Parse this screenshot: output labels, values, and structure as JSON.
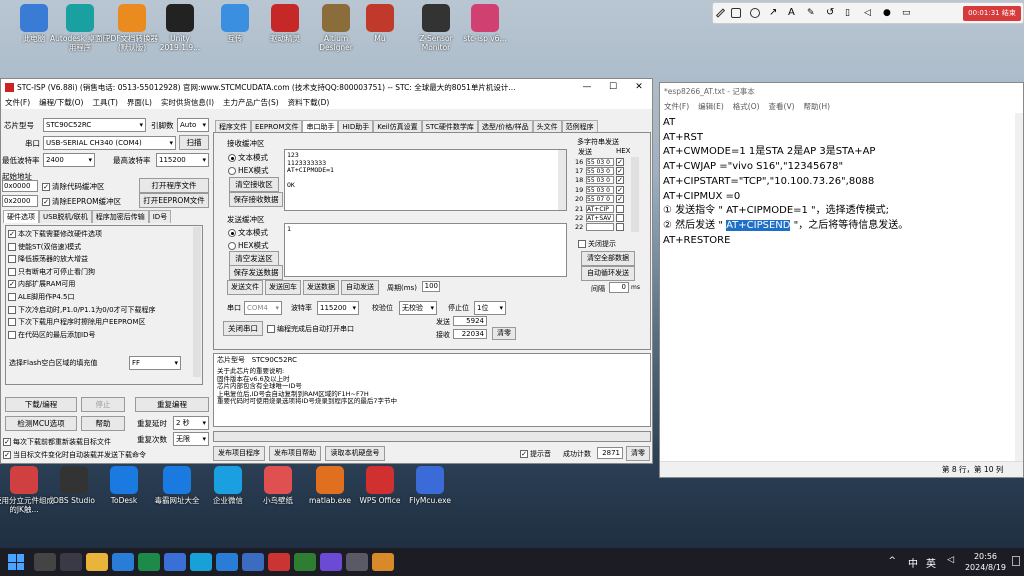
{
  "desktop": {
    "top_icons": [
      "此电脑",
      "Autodesk 桌面应用程序",
      "PDF文档转换器(默认版)",
      "Unity 2019.1.9...",
      "互传",
      "驱动精灵",
      "Altium Designer",
      "Mu",
      "Z-Sensor Monitor",
      "stc-isp v6..."
    ],
    "bottom_icons": [
      "使用分立元件组成的JK触...",
      "OBS Studio",
      "ToDesk",
      "毒霸网址大全",
      "企业微信",
      "小鸟壁纸",
      "matlab.exe",
      "WPS Office",
      "FlyMcu.exe"
    ]
  },
  "recorder": {
    "time": "00:01:31",
    "stop": "结束"
  },
  "stc": {
    "title": "STC-ISP (V6.88i) (销售电话: 0513-55012928) 官网:www.STCMCUDATA.com (技术支持QQ:800003751) -- STC: 全球最大的8051单片机设计...",
    "menu": [
      "文件(F)",
      "编程/下载(O)",
      "工具(T)",
      "界面(L)",
      "实时供货信息(I)",
      "主力产品广告(S)",
      "资料下载(D)"
    ],
    "chip_label": "芯片型号",
    "chip": "STC90C52RC",
    "pins_label": "引脚数",
    "pins": "Auto",
    "port_label": "串口",
    "port": "USB-SERIAL CH340 (COM4)",
    "scan": "扫描",
    "min_baud_label": "最低波特率",
    "min_baud": "2400",
    "max_baud_label": "最高波特率",
    "max_baud": "115200",
    "start_addr_label": "起始地址",
    "addr1": "0x0000",
    "clear_code": "清除代码缓冲区",
    "open_prog": "打开程序文件",
    "addr2": "0x2000",
    "clear_eeprom": "清除EEPROM缓冲区",
    "open_eeprom": "打开EEPROM文件",
    "left_tabs": [
      "硬件选项",
      "USB脱机/联机",
      "程序加密后传输",
      "ID号"
    ],
    "options": [
      {
        "text": "本次下载需要修改硬件选项",
        "checked": true
      },
      {
        "text": "使能ST(双倍速)模式",
        "checked": false
      },
      {
        "text": "降低振荡器的放大增益",
        "checked": false
      },
      {
        "text": "只有断电才可停止看门狗",
        "checked": false
      },
      {
        "text": "内部扩展RAM可用",
        "checked": true
      },
      {
        "text": "ALE脚用作P4.5口",
        "checked": false
      },
      {
        "text": "下次冷启动时,P1.0/P1.1为0/0才可下载程序",
        "checked": false
      },
      {
        "text": "下次下载用户程序时擦除用户EEPROM区",
        "checked": false
      },
      {
        "text": "在代码区的最后添加ID号",
        "checked": false
      }
    ],
    "fill_label": "选择Flash空白区域的填充值",
    "fill": "FF",
    "btn_download": "下载/编程",
    "btn_stop": "停止",
    "btn_reprog": "重复编程",
    "btn_detect": "检测MCU选项",
    "btn_help": "帮助",
    "delay_label": "重复延时",
    "delay": "2 秒",
    "repeat_label": "重复次数",
    "repeat": "无限",
    "reload": "每次下载前都重新装载目标文件",
    "auto_send": "当目标文件变化时自动装载并发送下载命令",
    "right_tabs": [
      "程序文件",
      "EEPROM文件",
      "串口助手",
      "HID助手",
      "Keil仿真设置",
      "STC硬件数学库",
      "选型/价格/样品",
      "头文件",
      "范例程序"
    ],
    "recv_label": "接收缓冲区",
    "text_mode": "文本模式",
    "hex_mode": "HEX模式",
    "clear_recv": "清空接收区",
    "save_recv": "保存接收数据",
    "recv_text": [
      "123",
      "1123333333",
      "AT+CIPMODE=1",
      "",
      "OK"
    ],
    "send_label": "发送缓冲区",
    "clear_send": "清空发送区",
    "save_send": "保存发送数据",
    "send_text": "1",
    "multi_label": "多字符串发送",
    "send_col": "发送",
    "hex_col": "HEX",
    "multi_rows": [
      {
        "n": "16",
        "v": "55 03 0"
      },
      {
        "n": "17",
        "v": "55 03 0"
      },
      {
        "n": "18",
        "v": "55 03 0"
      },
      {
        "n": "19",
        "v": "55 03 0"
      },
      {
        "n": "20",
        "v": "55 07 0"
      },
      {
        "n": "21",
        "v": "AT+CIP"
      },
      {
        "n": "22",
        "v": "AT+SAV"
      },
      {
        "n": "22",
        "v": ""
      }
    ],
    "close_hint": "关闭提示",
    "clear_all": "清空全部数据",
    "auto_loop": "自动循环发送",
    "interval_label": "间隔",
    "interval": "0",
    "ms": "ms",
    "send_file": "发送文件",
    "send_return": "发送回车",
    "send_data": "发送数据",
    "auto_send_btn": "自动发送",
    "period_label": "周期(ms)",
    "period": "100",
    "port2_label": "串口",
    "port2": "COM4",
    "baud_label": "波特率",
    "baud": "115200",
    "parity_label": "校验位",
    "parity": "无校验",
    "stop_label": "停止位",
    "stop": "1位",
    "close_port": "关闭串口",
    "auto_open": "编程完成后自动打开串口",
    "sent_label": "发送",
    "sent": "5924",
    "recv_count_label": "接收",
    "recv_count": "22034",
    "zero": "清零",
    "chip_info_label": "芯片型号",
    "chip_info": "STC90C52RC",
    "info_lines": [
      "关于此芯片的重要说明:",
      "  固件版本在v6.6及以上时",
      "    芯片内部包含有全球唯一ID号",
      "    上电复位后,ID号会自动复制到RAM区域的F1H~F7H",
      "    重要代码时可使用烧录选项将ID号烧录到程序区的最后7字节中"
    ],
    "publish": "发布项目程序",
    "publish_help": "发布项目帮助",
    "read_disk": "读取本机硬盘号",
    "beep": "提示音",
    "success_label": "成功计数",
    "success": "2871",
    "clear": "清零"
  },
  "notepad": {
    "title": "*esp8266_AT.txt - 记事本",
    "menu": [
      "文件(F)",
      "编辑(E)",
      "格式(O)",
      "查看(V)",
      "帮助(H)"
    ],
    "lines": [
      {
        "t": "AT"
      },
      {
        "t": "AT+RST"
      },
      {
        "t": "AT+CWMODE=1       1是STA   2是AP   3是STA+AP"
      },
      {
        "t": "AT+CWJAP =\"vivo S16\",\"12345678\""
      },
      {
        "t": "AT+CIPSTART=\"TCP\",\"10.100.73.26\",8088"
      },
      {
        "t": "AT+CIPMUX =0"
      },
      {
        "t": "① 发送指令 \" AT+CIPMODE=1 \"，选择透传模式;"
      },
      {
        "pre": "② 然后发送 \" ",
        "hl": "AT+CIPSEND",
        "post": " \"，之后将等待信息发送。"
      },
      {
        "t": "AT+RESTORE"
      }
    ],
    "status": "第 8 行，第 10 列"
  },
  "taskbar": {
    "time": "20:56",
    "date": "2024/8/19",
    "ime": "中",
    "lang": "英"
  }
}
